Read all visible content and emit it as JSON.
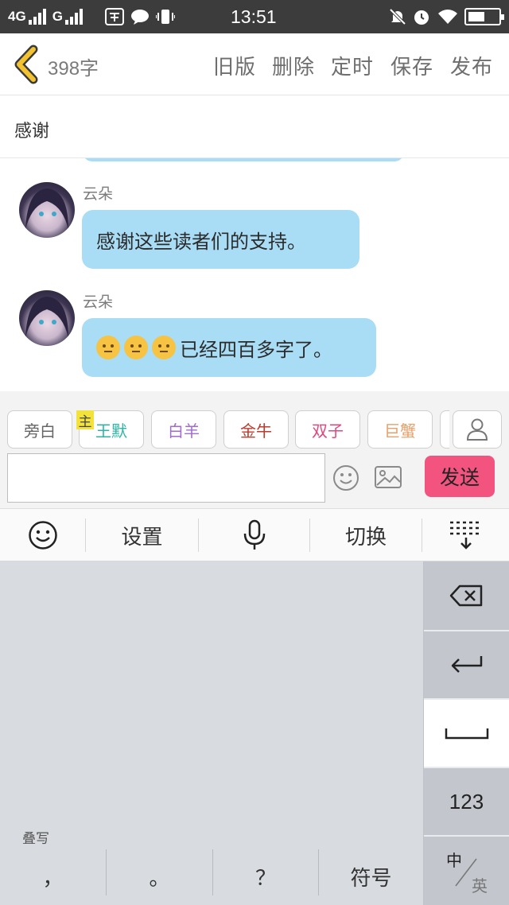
{
  "status_bar": {
    "network_1": "4G",
    "network_2": "G",
    "time": "13:51",
    "icons": [
      "signal-icon",
      "signal-icon",
      "wechat-pay-icon",
      "chat-icon",
      "vibrate-icon",
      "mute-icon",
      "alarm-icon",
      "wifi-icon",
      "battery-icon"
    ]
  },
  "nav": {
    "word_count": "398字",
    "actions": [
      "旧版",
      "删除",
      "定时",
      "保存",
      "发布"
    ],
    "back_color": "#f2c230"
  },
  "title": "感谢",
  "messages": [
    {
      "sender": "云朵",
      "text": "感谢这些读者们的支持。",
      "emoji_count": 0
    },
    {
      "sender": "云朵",
      "text": "已经四百多字了。",
      "emoji_count": 3,
      "emoji": "sweat-smile-emoji"
    }
  ],
  "roles": {
    "main_tag": "主",
    "chips": [
      {
        "label": "旁白",
        "color": "#666666"
      },
      {
        "label": "王默",
        "color": "#2bb5a4"
      },
      {
        "label": "白羊",
        "color": "#a26ccf"
      },
      {
        "label": "金牛",
        "color": "#c0392b"
      },
      {
        "label": "双子",
        "color": "#e0487a"
      },
      {
        "label": "巨蟹",
        "color": "#e8a06a"
      }
    ]
  },
  "composer": {
    "input_value": "",
    "send_label": "发送",
    "send_color": "#f2547f"
  },
  "keyboard": {
    "toolbar": {
      "settings": "设置",
      "switch": "切换"
    },
    "overlay_label": "叠写",
    "bottom_keys": [
      "，",
      "。",
      "？",
      "符号"
    ],
    "key_123": "123",
    "lang_primary": "中",
    "lang_secondary": "英"
  }
}
